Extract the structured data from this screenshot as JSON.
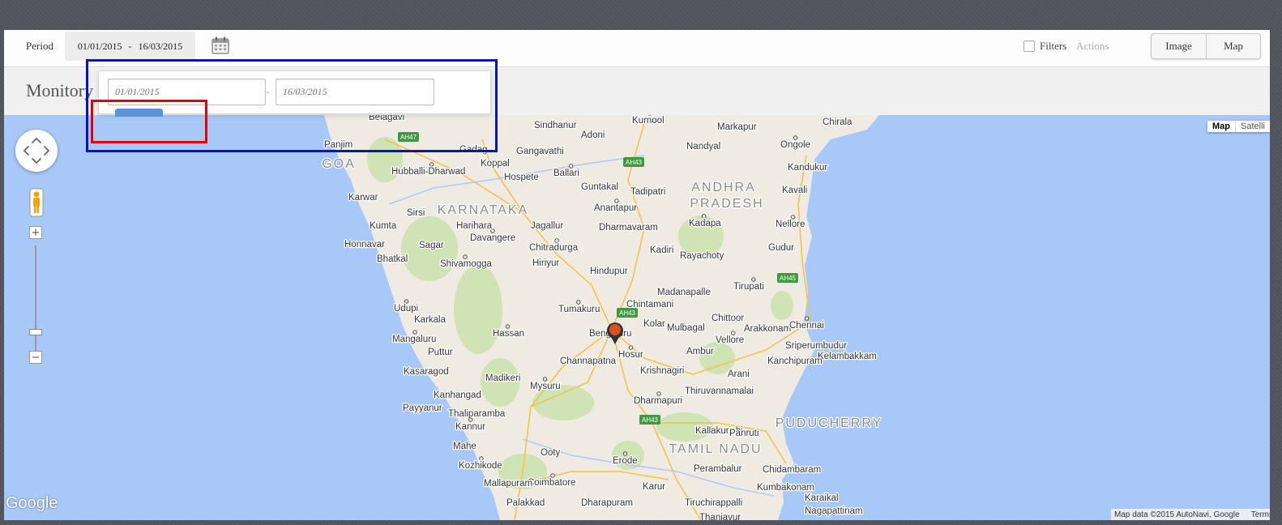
{
  "toolbar": {
    "period_label": "Period",
    "period_start": "01/01/2015",
    "period_separator": "-",
    "period_end": "16/03/2015",
    "calendar_icon": "calendar-icon",
    "filters_label": "Filters",
    "filters_checked": false,
    "actions_label": "Actions",
    "view_buttons": [
      "Image",
      "Map"
    ]
  },
  "page": {
    "title": "Monitory"
  },
  "date_popup": {
    "start_placeholder": "01/01/2015",
    "separator": "-",
    "end_placeholder": "16/03/2015"
  },
  "annotations": {
    "outline_popup_color": "#0a10c7",
    "outline_button_color": "#e00000"
  },
  "map": {
    "type_buttons": [
      "Map",
      "Satelli"
    ],
    "logo": "Google",
    "attribution": "Map data ©2015 AutoNavi, Google",
    "terms": "Terms of",
    "marker_color": "#d9531e",
    "regions": [
      "GOA",
      "KARNATAKA",
      "ANDHRA",
      "PRADESH",
      "TAMIL NADU",
      "PUDUCHERRY"
    ],
    "places": [
      "Belagavi",
      "Panjim",
      "Hubballi-Dharwad",
      "Karwar",
      "Sirsi",
      "Kumta",
      "Honnavar",
      "Bhatkal",
      "Sagar",
      "Shivamogga",
      "Davangere",
      "Harihara",
      "Jagallur",
      "Chitradurga",
      "Hiriyur",
      "Gadag",
      "Koppal",
      "Hospete",
      "Gangavathi",
      "Sindhanur",
      "Adoni",
      "Ballari",
      "Kurnool",
      "Markapur",
      "Nandyal",
      "Chirala",
      "Ongole",
      "Kandukur",
      "Kavali",
      "Nellore",
      "Gudur",
      "Guntakal",
      "Tadipatri",
      "Anantapur",
      "Dharmavaram",
      "Kadapa",
      "Kadiri",
      "Rayachoty",
      "Hindupur",
      "Madanapalle",
      "Tirupati",
      "Chintamani",
      "Tumakuru",
      "Bengaluru",
      "Kolar",
      "Mulbagal",
      "Chittoor",
      "Arakkonam",
      "Chennai",
      "Sriperumbudur",
      "Kelambakkam",
      "Kanchipuram",
      "Vellore",
      "Ambur",
      "Arani",
      "Hosur",
      "Krishnagiri",
      "Channapatna",
      "Hassan",
      "Udupi",
      "Karkala",
      "Mangaluru",
      "Puttur",
      "Kasaragod",
      "Madikeri",
      "Mysuru",
      "Kanhangad",
      "Payyanur",
      "Thaliparamba",
      "Kannur",
      "Mahe",
      "Kozhikode",
      "Ooty",
      "Coimbatore",
      "Mallapuram",
      "Palakkad",
      "Dharapuram",
      "Erode",
      "Dharmapuri",
      "Thiruvannamalai",
      "Kallakurichi",
      "Panruti",
      "Perambalur",
      "Chidambaram",
      "Karur",
      "Tiruchirappalli",
      "Kumbakonam",
      "Karaikal",
      "Nagapattinam",
      "Thanjavur"
    ],
    "highways": [
      "AH47",
      "AH43",
      "AH43",
      "AH45",
      "AH43"
    ]
  }
}
